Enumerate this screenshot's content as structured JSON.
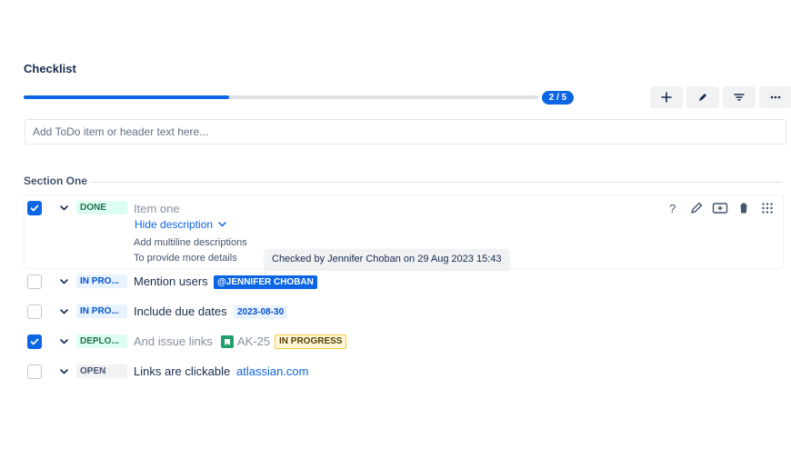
{
  "checklist": {
    "title": "Checklist",
    "progress": {
      "completed": 2,
      "total": 5,
      "label": "2 / 5"
    },
    "toolbar": [
      {
        "name": "add",
        "icon": "plus-icon"
      },
      {
        "name": "edit",
        "icon": "pencil-icon"
      },
      {
        "name": "filter",
        "icon": "filter-icon"
      },
      {
        "name": "more",
        "icon": "ellipsis-icon"
      }
    ],
    "add_input": {
      "placeholder": "Add ToDo item or header text here...",
      "value": ""
    },
    "section": {
      "label": "Section One"
    },
    "items": [
      {
        "checked": true,
        "status": "DONE",
        "text": "Item one",
        "description_toggle": "Hide description",
        "description": [
          "Add multiline descriptions",
          "To provide more details"
        ],
        "tooltip": "Checked by Jennifer Choban on 29 Aug 2023 15:43",
        "actions": [
          "question-icon",
          "pencil-icon",
          "add-card-icon",
          "trash-icon",
          "drag-grid-icon"
        ]
      },
      {
        "checked": false,
        "status": "IN PRO...",
        "text": "Mention users",
        "mention": "@JENNIFER CHOBAN"
      },
      {
        "checked": false,
        "status": "IN PRO...",
        "text": "Include due dates",
        "due_date": "2023-08-30"
      },
      {
        "checked": true,
        "status": "DEPLO...",
        "text": "And issue links",
        "issue": {
          "key": "AK-25",
          "status": "IN PROGRESS"
        }
      },
      {
        "checked": false,
        "status": "OPEN",
        "text": "Links are clickable",
        "link": "atlassian.com"
      }
    ]
  },
  "colors": {
    "accent": "#0c66e4",
    "done_bg": "#dcfff1",
    "progress_bg": "#e9f2ff",
    "issue_status_bg": "#fff7d6",
    "issue_icon": "#22a06b"
  }
}
